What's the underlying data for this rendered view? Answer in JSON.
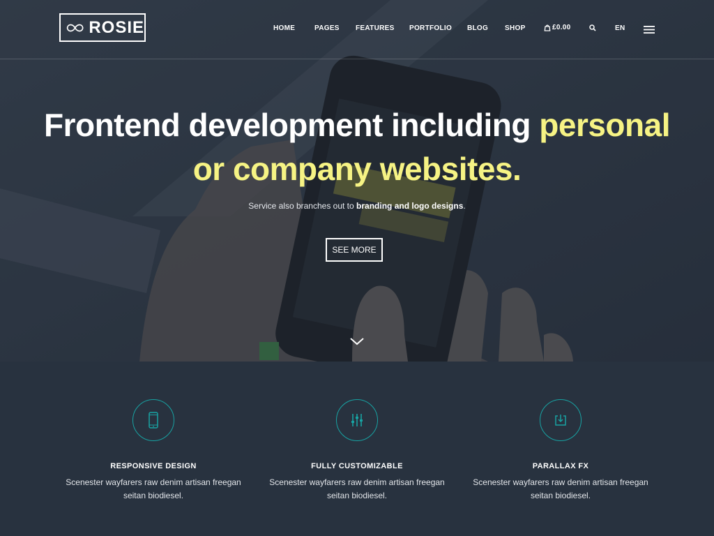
{
  "brand": {
    "name": "ROSIE"
  },
  "nav": {
    "items": [
      "HOME",
      "PAGES",
      "FEATURES",
      "PORTFOLIO",
      "BLOG",
      "SHOP"
    ],
    "cart_total": "£0.00",
    "language": "EN"
  },
  "hero": {
    "headline_white": "Frontend development including ",
    "headline_highlight_1": "personal",
    "headline_highlight_2": "or company websites.",
    "sub_prefix": "Service also branches out to ",
    "sub_bold": "branding and logo designs",
    "sub_suffix": ".",
    "cta_label": "SEE MORE",
    "highlight_color": "#f6f384"
  },
  "features": [
    {
      "icon": "smartphone-icon",
      "title": "RESPONSIVE DESIGN",
      "desc": "Scenester wayfarers raw denim artisan freegan seitan biodiesel."
    },
    {
      "icon": "sliders-icon",
      "title": "FULLY CUSTOMIZABLE",
      "desc": "Scenester wayfarers raw denim artisan freegan seitan biodiesel."
    },
    {
      "icon": "download-icon",
      "title": "PARALLAX FX",
      "desc": "Scenester wayfarers raw denim artisan freegan seitan biodiesel."
    }
  ],
  "colors": {
    "accent_teal": "#18a3a3",
    "background": "#28323f"
  }
}
